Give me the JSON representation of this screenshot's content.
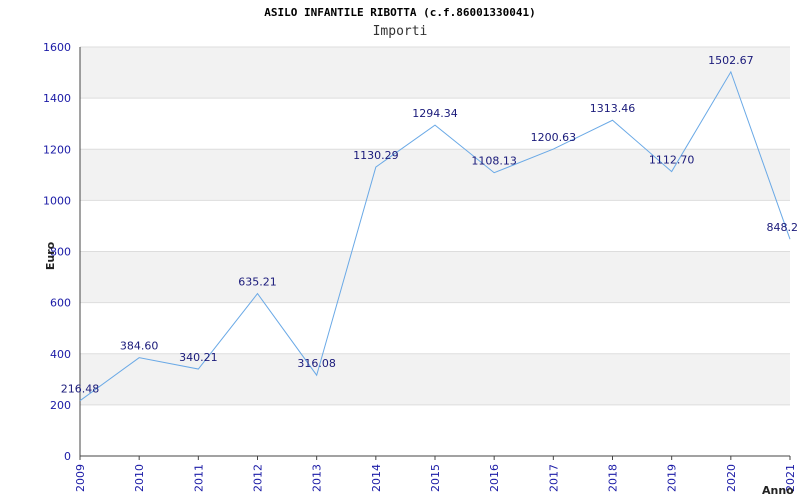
{
  "chart_data": {
    "type": "line",
    "title": "ASILO INFANTILE RIBOTTA (c.f.86001330041)",
    "subtitle": "Importi",
    "xlabel": "Anno",
    "ylabel": "Euro",
    "x": [
      "2009",
      "2010",
      "2011",
      "2012",
      "2013",
      "2014",
      "2015",
      "2016",
      "2017",
      "2018",
      "2019",
      "2020",
      "2021"
    ],
    "series": [
      {
        "values": [
          216.48,
          384.6,
          340.21,
          635.21,
          316.08,
          1130.29,
          1294.34,
          1108.13,
          1200.63,
          1313.46,
          1112.7,
          1502.67,
          848.2
        ],
        "labels": [
          "216.48",
          "384.60",
          "340.21",
          "635.21",
          "316.08",
          "1130.29",
          "1294.34",
          "1108.13",
          "1200.63",
          "1313.46",
          "1112.70",
          "1502.67",
          "848.2"
        ],
        "color": "#6aa9e6"
      }
    ],
    "ylim": [
      0,
      1600
    ],
    "yticks": [
      "0",
      "200",
      "400",
      "600",
      "800",
      "1000",
      "1200",
      "1400",
      "1600"
    ],
    "grid": true,
    "band_colors": [
      "#ffffff",
      "#f2f2f2"
    ],
    "gridline_color": "#dddddd"
  }
}
